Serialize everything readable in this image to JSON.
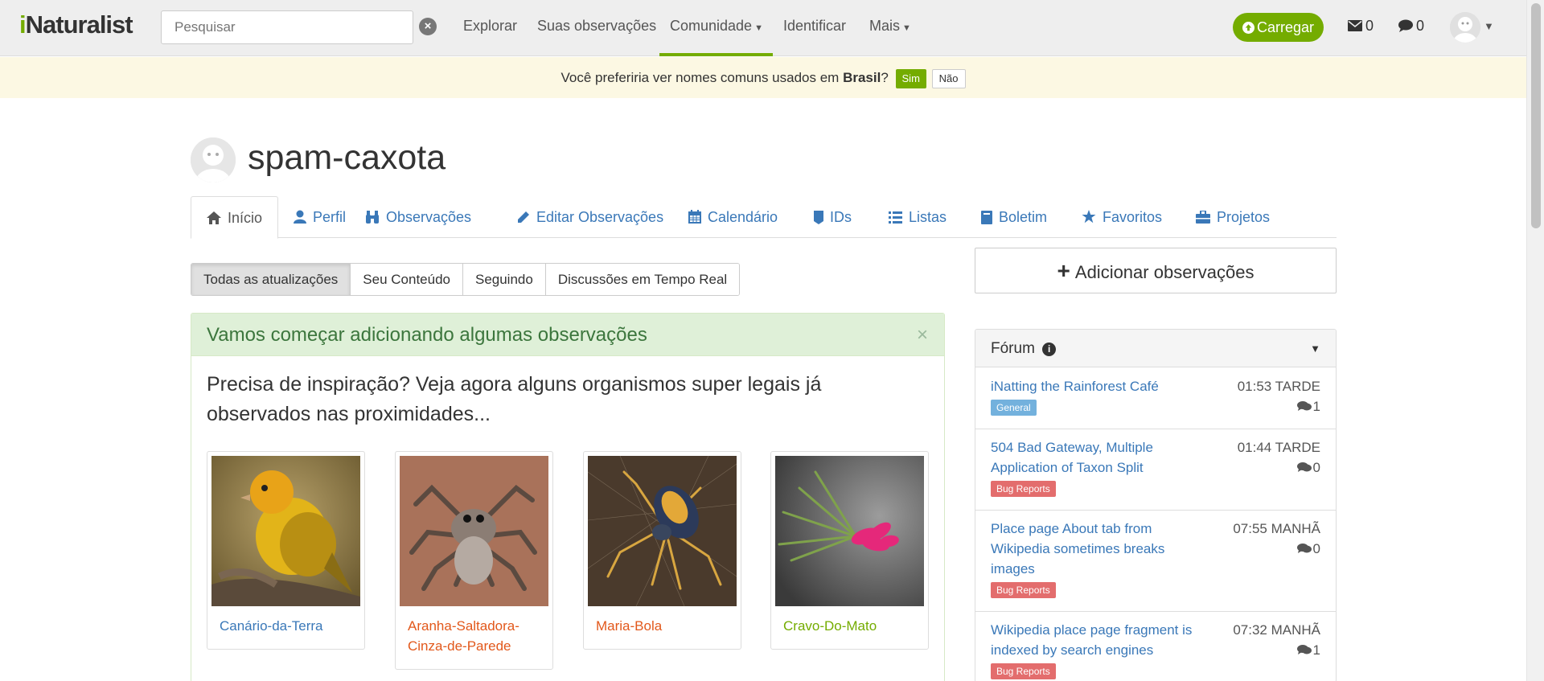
{
  "header": {
    "logo_i": "i",
    "logo_rest": "Naturalist",
    "search_placeholder": "Pesquisar",
    "clear_glyph": "×",
    "nav": [
      {
        "label": "Explorar"
      },
      {
        "label": "Suas observações"
      },
      {
        "label": "Comunidade",
        "caret": "⌄"
      },
      {
        "label": "Identificar"
      },
      {
        "label": "Mais",
        "caret": "⌄"
      }
    ],
    "upload_label": "Carregar",
    "messages_count": "0",
    "comments_count": "0",
    "colors": {
      "brand_green": "#74ac00",
      "link_blue": "#3a78b8"
    }
  },
  "notice": {
    "text_before": "Você preferiria ver nomes comuns usados em ",
    "place": "Brasil",
    "text_after": "?",
    "yes_label": "Sim",
    "no_label": "Não"
  },
  "profile": {
    "username": "spam-caxota",
    "tabs": [
      {
        "label": "Início",
        "icon": "home-icon"
      },
      {
        "label": "Perfil",
        "icon": "user-icon"
      },
      {
        "label": "Observações",
        "icon": "binoculars-icon"
      },
      {
        "label": "Editar Observações",
        "icon": "pencil-icon"
      },
      {
        "label": "Calendário",
        "icon": "calendar-icon"
      },
      {
        "label": "IDs",
        "icon": "tag-icon"
      },
      {
        "label": "Listas",
        "icon": "list-icon"
      },
      {
        "label": "Boletim",
        "icon": "book-icon"
      },
      {
        "label": "Favoritos",
        "icon": "star-icon"
      },
      {
        "label": "Projetos",
        "icon": "briefcase-icon"
      }
    ]
  },
  "filters": [
    {
      "label": "Todas as atualizações"
    },
    {
      "label": "Seu Conteúdo"
    },
    {
      "label": "Seguindo"
    },
    {
      "label": "Discussões em Tempo Real"
    }
  ],
  "welcome": {
    "heading": "Vamos começar adicionando algumas observações",
    "close_glyph": "×",
    "inspiration": "Precisa de inspiração? Veja agora alguns organismos super legais já observados nas proximidades...",
    "taxa": [
      {
        "name": "Canário-da-Terra",
        "color": "#3a78b8"
      },
      {
        "name": "Aranha-Saltadora-Cinza-de-Parede",
        "color": "#e2581b"
      },
      {
        "name": "Maria-Bola",
        "color": "#e2581b"
      },
      {
        "name": "Cravo-Do-Mato",
        "color": "#74ac00"
      }
    ]
  },
  "sidebar": {
    "add_observations": "Adicionar observações",
    "forum_title": "Fórum",
    "forum_topics": [
      {
        "title": "iNatting the Rainforest Café",
        "time": "01:53 TARDE",
        "replies": "1",
        "category": "General"
      },
      {
        "title": "504 Bad Gateway, Multiple Application of Taxon Split",
        "time": "01:44 TARDE",
        "replies": "0",
        "category": "Bug Reports"
      },
      {
        "title": "Place page About tab from Wikipedia sometimes breaks images",
        "time": "07:55 MANHÃ",
        "replies": "0",
        "category": "Bug Reports"
      },
      {
        "title": "Wikipedia place page fragment is indexed by search engines",
        "time": "07:32 MANHÃ",
        "replies": "1",
        "category": "Bug Reports"
      }
    ]
  }
}
